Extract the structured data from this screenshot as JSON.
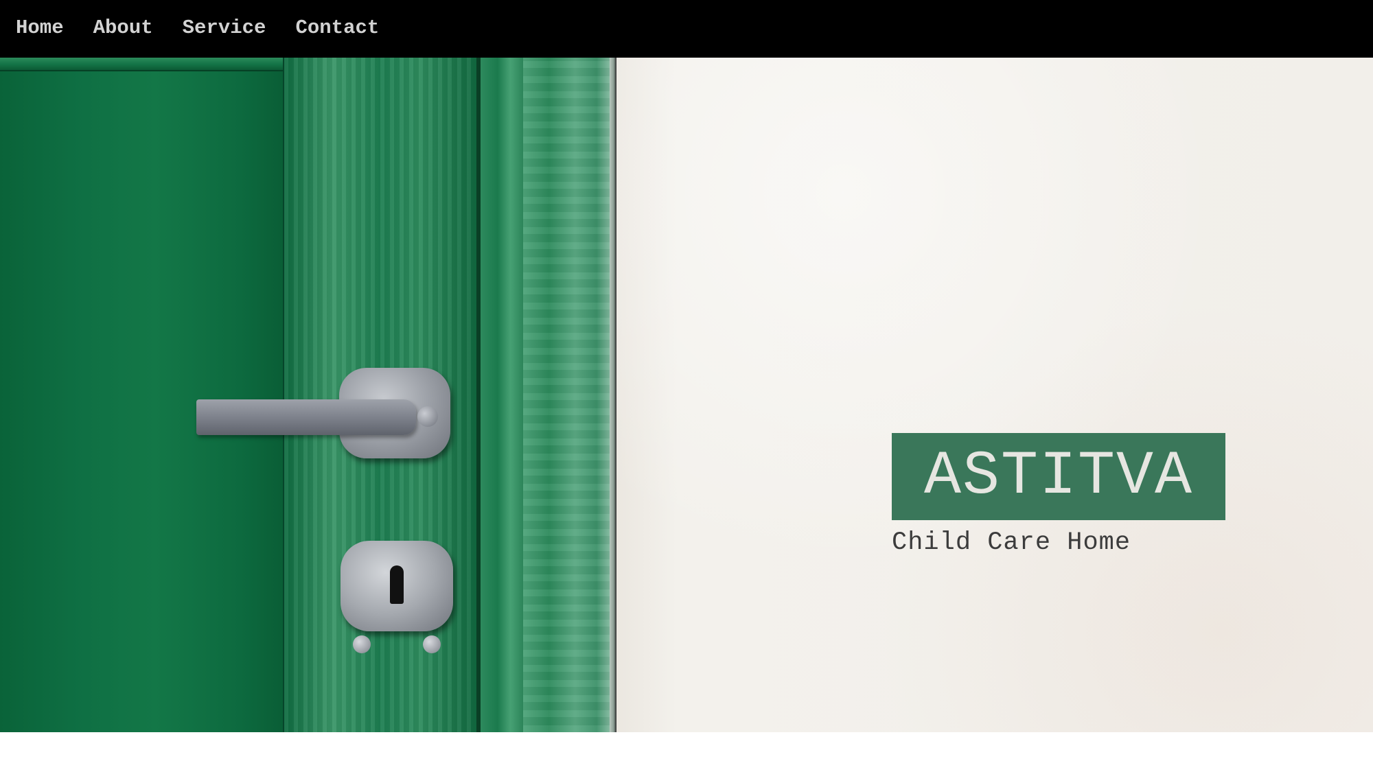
{
  "nav": {
    "items": [
      {
        "label": "Home"
      },
      {
        "label": "About"
      },
      {
        "label": "Service"
      },
      {
        "label": "Contact"
      }
    ]
  },
  "hero": {
    "title": "ASTITVA",
    "subtitle": "Child Care Home",
    "image": {
      "door_color": "#0b6a3e",
      "wall_color": "#f2efea",
      "brand_box_color": "#3a775a"
    }
  }
}
